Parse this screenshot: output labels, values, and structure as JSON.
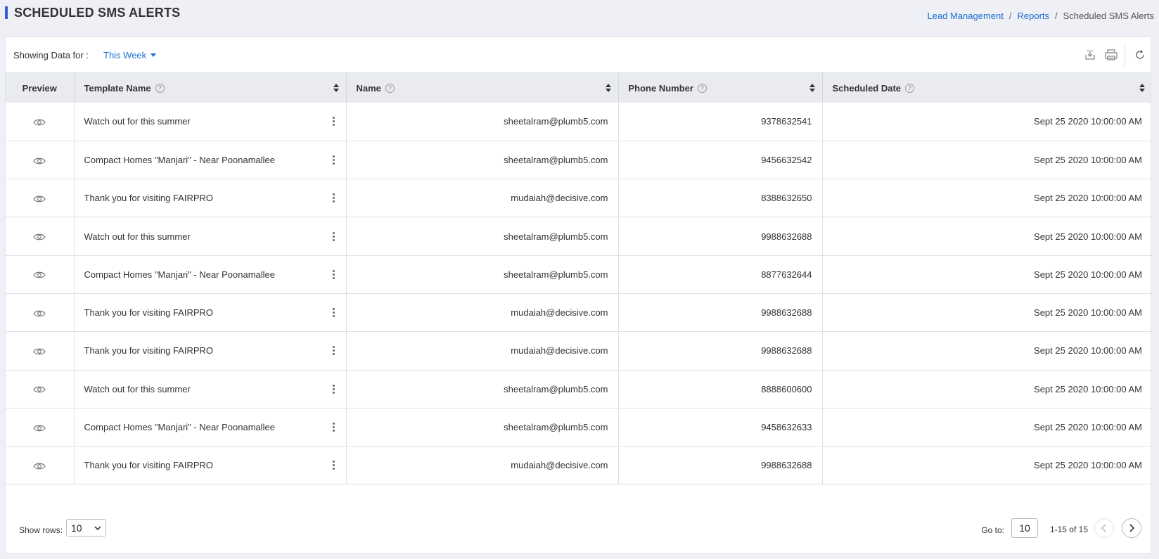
{
  "page": {
    "title": "SCHEDULED SMS ALERTS",
    "breadcrumb": [
      {
        "label": "Lead Management",
        "link": true
      },
      {
        "label": "Reports",
        "link": true
      },
      {
        "label": "Scheduled SMS Alerts",
        "link": false
      }
    ],
    "breadcrumb_separator": "/"
  },
  "toolbar": {
    "showing_label": "Showing Data for :",
    "period": "This Week",
    "icons": [
      "download-icon",
      "print-icon",
      "refresh-icon"
    ]
  },
  "table": {
    "columns": [
      {
        "label": "Preview",
        "help": false,
        "sortable": false
      },
      {
        "label": "Template Name",
        "help": true,
        "sortable": true
      },
      {
        "label": "Name",
        "help": true,
        "sortable": true
      },
      {
        "label": "Phone Number",
        "help": true,
        "sortable": true
      },
      {
        "label": "Scheduled Date",
        "help": true,
        "sortable": true
      }
    ],
    "rows": [
      {
        "template": "Watch out for this summer",
        "name": "sheetalram@plumb5.com",
        "phone": "9378632541",
        "date": "Sept 25 2020 10:00:00 AM"
      },
      {
        "template": "Compact Homes \"Manjari\" - Near Poonamallee",
        "name": "sheetalram@plumb5.com",
        "phone": "9456632542",
        "date": "Sept 25 2020 10:00:00 AM"
      },
      {
        "template": "Thank you for visiting FAIRPRO",
        "name": "mudaiah@decisive.com",
        "phone": "8388632650",
        "date": "Sept 25 2020 10:00:00 AM"
      },
      {
        "template": "Watch out for this summer",
        "name": "sheetalram@plumb5.com",
        "phone": "9988632688",
        "date": "Sept 25 2020 10:00:00 AM"
      },
      {
        "template": "Compact Homes \"Manjari\" - Near Poonamallee",
        "name": "sheetalram@plumb5.com",
        "phone": "8877632644",
        "date": "Sept 25 2020 10:00:00 AM"
      },
      {
        "template": "Thank you for visiting FAIRPRO",
        "name": "mudaiah@decisive.com",
        "phone": "9988632688",
        "date": "Sept 25 2020 10:00:00 AM"
      },
      {
        "template": "Thank you for visiting FAIRPRO",
        "name": "mudaiah@decisive.com",
        "phone": "9988632688",
        "date": "Sept 25 2020 10:00:00 AM"
      },
      {
        "template": "Watch out for this summer",
        "name": "sheetalram@plumb5.com",
        "phone": "8888600600",
        "date": "Sept 25 2020 10:00:00 AM"
      },
      {
        "template": "Compact Homes \"Manjari\" - Near Poonamallee",
        "name": "sheetalram@plumb5.com",
        "phone": "9458632633",
        "date": "Sept 25 2020 10:00:00 AM"
      },
      {
        "template": "Thank you for visiting FAIRPRO",
        "name": "mudaiah@decisive.com",
        "phone": "9988632688",
        "date": "Sept 25 2020 10:00:00 AM"
      }
    ]
  },
  "footer": {
    "rows_label": "Show rows:",
    "rows_value": "10",
    "goto_label": "Go to:",
    "goto_value": "10",
    "range_text": "1-15 of 15"
  },
  "colors": {
    "accent": "#3b5bdb",
    "link": "#1c6dd0",
    "header_bg": "#e9ebef",
    "page_bg": "#eef0f5"
  }
}
